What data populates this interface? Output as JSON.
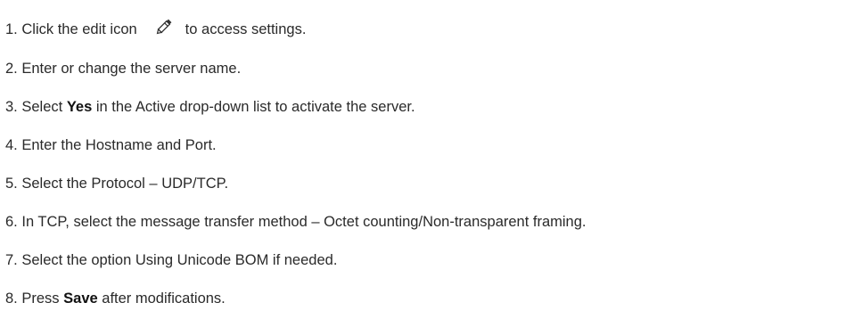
{
  "steps": [
    {
      "number": "1.",
      "text_before": "Click the edit icon",
      "icon": "pencil-edit-icon",
      "text_after": "to access settings."
    },
    {
      "number": "2.",
      "text": "Enter or change the server name."
    },
    {
      "number": "3.",
      "text_before": "Select",
      "bold": "Yes",
      "text_after": "in the Active drop-down list to activate the server."
    },
    {
      "number": "4.",
      "text": "Enter the Hostname and Port."
    },
    {
      "number": "5.",
      "text": "Select the Protocol – UDP/TCP."
    },
    {
      "number": "6.",
      "text": "In TCP, select the message transfer method – Octet counting/Non-transparent framing."
    },
    {
      "number": "7.",
      "text": "Select the option Using Unicode BOM if needed."
    },
    {
      "number": "8.",
      "text_before": "Press",
      "bold": "Save",
      "text_after": "after modifications."
    }
  ]
}
